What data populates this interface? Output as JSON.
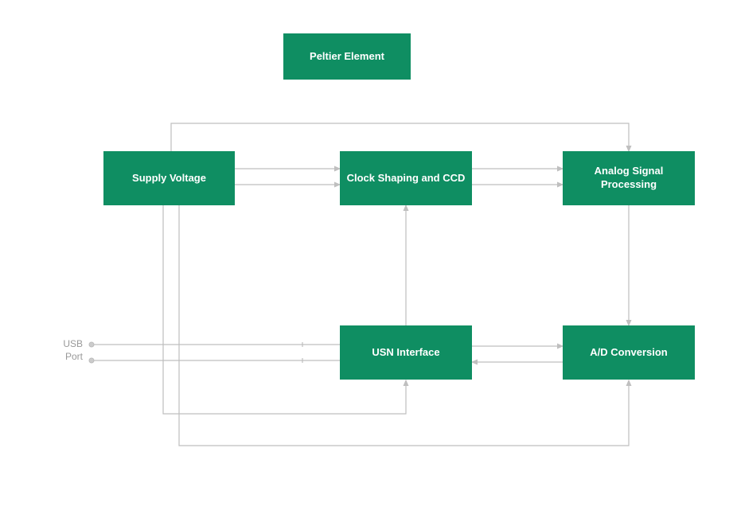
{
  "blocks": {
    "peltier": {
      "label": "Peltier Element"
    },
    "supply_voltage": {
      "label": "Supply Voltage"
    },
    "clock_shaping": {
      "label": "Clock Shaping and CCD"
    },
    "analog_signal": {
      "label": "Analog Signal Processing"
    },
    "usn_interface": {
      "label": "USN Interface"
    },
    "ad_conversion": {
      "label": "A/D Conversion"
    },
    "usb_port": {
      "line1": "USB",
      "line2": "Port"
    }
  },
  "colors": {
    "block_bg": "#0f8e62",
    "block_fg": "#ffffff",
    "connector": "#bfbfbf",
    "label": "#999999"
  }
}
